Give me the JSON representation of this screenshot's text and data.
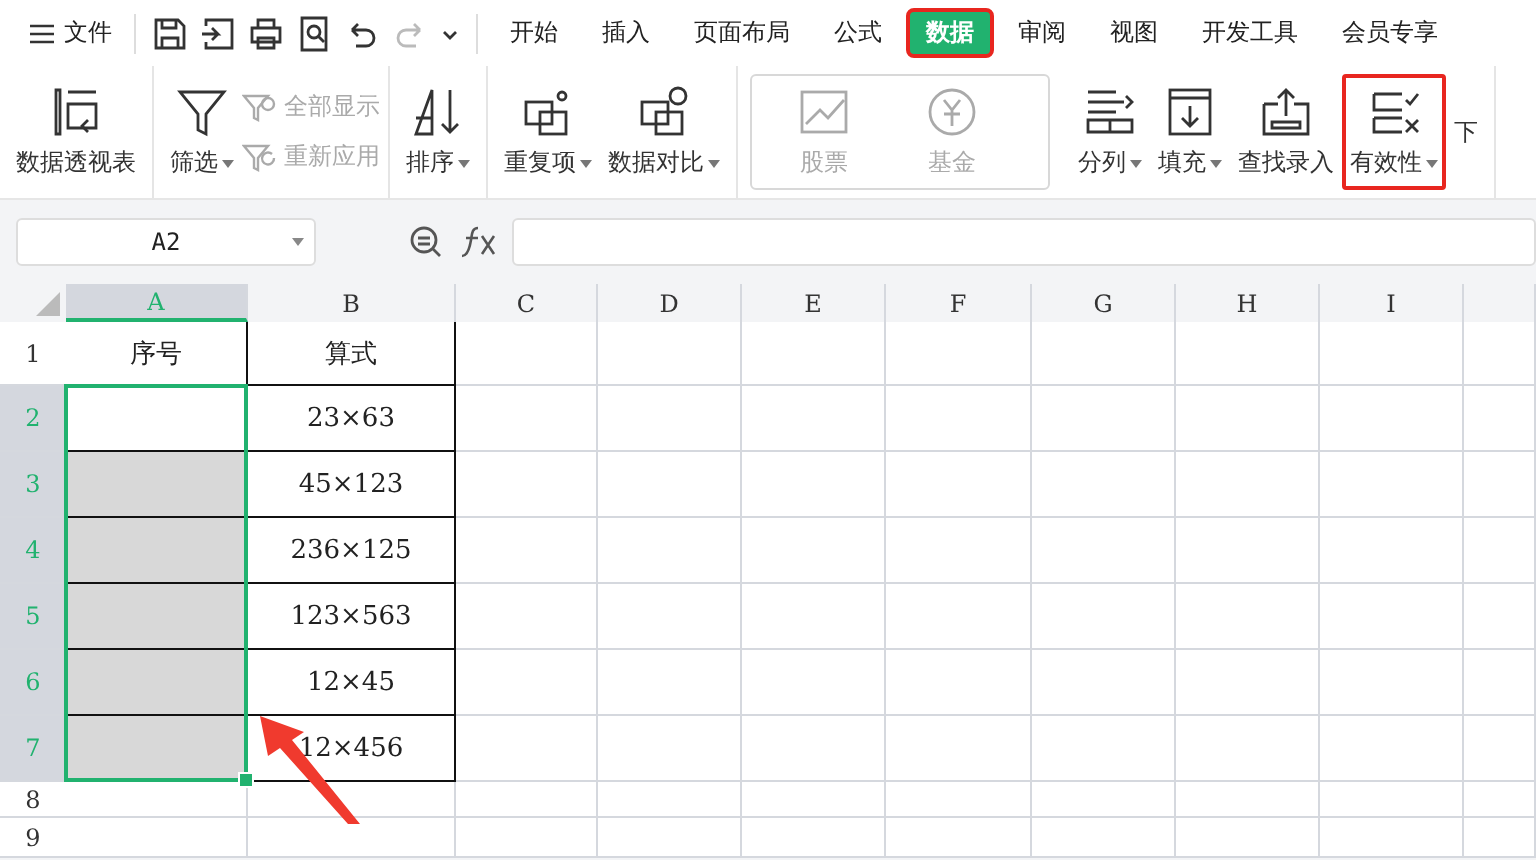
{
  "menu": {
    "label": "文件"
  },
  "quick_access": [
    {
      "kind": "save",
      "disabled": false
    },
    {
      "kind": "export",
      "disabled": false
    },
    {
      "kind": "print",
      "disabled": false
    },
    {
      "kind": "preview",
      "disabled": false
    },
    {
      "kind": "undo",
      "disabled": false
    },
    {
      "kind": "redo",
      "disabled": true
    },
    {
      "kind": "more",
      "disabled": false
    }
  ],
  "tabs": [
    {
      "label": "开始",
      "selected": false,
      "highlighted": false
    },
    {
      "label": "插入",
      "selected": false,
      "highlighted": false
    },
    {
      "label": "页面布局",
      "selected": false,
      "highlighted": false
    },
    {
      "label": "公式",
      "selected": false,
      "highlighted": false
    },
    {
      "label": "数据",
      "selected": true,
      "highlighted": true
    },
    {
      "label": "审阅",
      "selected": false,
      "highlighted": false
    },
    {
      "label": "视图",
      "selected": false,
      "highlighted": false
    },
    {
      "label": "开发工具",
      "selected": false,
      "highlighted": false
    },
    {
      "label": "会员专享",
      "selected": false,
      "highlighted": false
    }
  ],
  "ribbon": [
    {
      "kind": "group",
      "items": [
        {
          "kind": "large",
          "label": "数据透视表",
          "dropdown": false,
          "disabled": false,
          "highlighted": false
        }
      ]
    },
    {
      "kind": "group",
      "items": [
        {
          "kind": "large",
          "label": "筛选",
          "dropdown": true,
          "disabled": false,
          "highlighted": false
        },
        {
          "kind": "stack",
          "items": [
            {
              "label": "全部显示",
              "disabled": true
            },
            {
              "label": "重新应用",
              "disabled": true
            }
          ]
        }
      ]
    },
    {
      "kind": "group",
      "items": [
        {
          "kind": "large",
          "label": "排序",
          "dropdown": true,
          "disabled": false,
          "highlighted": false
        }
      ]
    },
    {
      "kind": "group",
      "items": [
        {
          "kind": "large",
          "label": "重复项",
          "dropdown": true,
          "disabled": false,
          "highlighted": false
        },
        {
          "kind": "large",
          "label": "数据对比",
          "dropdown": true,
          "disabled": false,
          "highlighted": false
        }
      ]
    },
    {
      "kind": "gallery",
      "items": [
        {
          "kind": "large",
          "label": "股票",
          "dropdown": false,
          "disabled": true,
          "highlighted": false
        },
        {
          "kind": "large",
          "label": "基金",
          "dropdown": false,
          "disabled": true,
          "highlighted": false
        }
      ]
    },
    {
      "kind": "group",
      "items": [
        {
          "kind": "large",
          "label": "分列",
          "dropdown": true,
          "disabled": false,
          "highlighted": false
        },
        {
          "kind": "large",
          "label": "填充",
          "dropdown": true,
          "disabled": false,
          "highlighted": false
        },
        {
          "kind": "large",
          "label": "查找录入",
          "dropdown": false,
          "disabled": false,
          "highlighted": false
        },
        {
          "kind": "large",
          "label": "有效性",
          "dropdown": true,
          "disabled": false,
          "highlighted": true
        },
        {
          "kind": "large",
          "label": "下",
          "dropdown": false,
          "disabled": false,
          "highlighted": false
        }
      ]
    }
  ],
  "formula_bar": {
    "name_box": "A2"
  },
  "sheet": {
    "columns": [
      {
        "label": "A",
        "selected": true
      },
      {
        "label": "B",
        "selected": false
      },
      {
        "label": "C",
        "selected": false
      },
      {
        "label": "D",
        "selected": false
      },
      {
        "label": "E",
        "selected": false
      },
      {
        "label": "F",
        "selected": false
      },
      {
        "label": "G",
        "selected": false
      },
      {
        "label": "H",
        "selected": false
      },
      {
        "label": "I",
        "selected": false
      }
    ],
    "rows": [
      {
        "label": "1",
        "selected": false,
        "cells": [
          {
            "text": "序号",
            "selected": false
          },
          {
            "text": "算式",
            "selected": false
          }
        ]
      },
      {
        "label": "2",
        "selected": true,
        "cells": [
          {
            "selected": false
          },
          {
            "text": "23×63",
            "selected": false
          }
        ]
      },
      {
        "label": "3",
        "selected": true,
        "cells": [
          {
            "selected": true
          },
          {
            "text": "45×123",
            "selected": false
          }
        ]
      },
      {
        "label": "4",
        "selected": true,
        "cells": [
          {
            "selected": true
          },
          {
            "text": "236×125",
            "selected": false
          }
        ]
      },
      {
        "label": "5",
        "selected": true,
        "cells": [
          {
            "selected": true
          },
          {
            "text": "123×563",
            "selected": false
          }
        ]
      },
      {
        "label": "6",
        "selected": true,
        "cells": [
          {
            "selected": true
          },
          {
            "text": "12×45",
            "selected": false
          }
        ]
      },
      {
        "label": "7",
        "selected": true,
        "cells": [
          {
            "selected": true
          },
          {
            "text": "12×456",
            "selected": false
          }
        ]
      },
      {
        "label": "8",
        "selected": false,
        "cells": []
      },
      {
        "label": "9",
        "selected": false,
        "cells": []
      }
    ]
  }
}
